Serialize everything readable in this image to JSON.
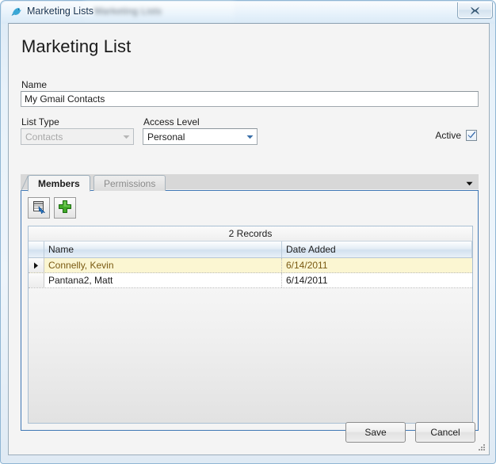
{
  "window": {
    "title": "Marketing Lists",
    "app_icon": "bird-icon",
    "background_ghost_text": "Marketing Lists",
    "close_label": "Close",
    "close_icon": "close-icon"
  },
  "page": {
    "title": "Marketing List"
  },
  "form": {
    "name": {
      "label": "Name",
      "value": "My Gmail Contacts",
      "placeholder": ""
    },
    "list_type": {
      "label": "List Type",
      "value": "Contacts",
      "disabled": true,
      "options": [
        "Contacts"
      ]
    },
    "access_level": {
      "label": "Access Level",
      "value": "Personal",
      "options": [
        "Personal"
      ]
    },
    "active": {
      "label": "Active",
      "checked": true
    }
  },
  "tabs": {
    "items": [
      {
        "label": "Members",
        "active": true
      },
      {
        "label": "Permissions",
        "active": false
      }
    ],
    "overflow_icon": "chevron-down-icon"
  },
  "toolbar": {
    "buttons": [
      {
        "name": "select-records-button",
        "icon": "grid-select-icon"
      },
      {
        "name": "add-record-button",
        "icon": "plus-icon"
      }
    ]
  },
  "grid": {
    "caption": "2 Records",
    "columns": [
      "Name",
      "Date Added"
    ],
    "rows": [
      {
        "indicator": "▶",
        "name": "Connelly, Kevin",
        "date_added": "6/14/2011",
        "selected": true
      },
      {
        "indicator": "",
        "name": "Pantana2, Matt",
        "date_added": "6/14/2011",
        "selected": false
      }
    ]
  },
  "footer": {
    "save_label": "Save",
    "cancel_label": "Cancel"
  },
  "colors": {
    "tab_accent": "#3f77b5",
    "selected_row": "#fbf6d2",
    "selected_row_text": "#7a5a12",
    "add_icon_green": "#41a928",
    "title_text": "#14314f"
  }
}
